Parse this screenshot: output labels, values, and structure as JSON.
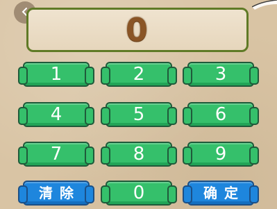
{
  "display": {
    "value": "0"
  },
  "keys": {
    "k1": "1",
    "k2": "2",
    "k3": "3",
    "k4": "4",
    "k5": "5",
    "k6": "6",
    "k7": "7",
    "k8": "8",
    "k9": "9",
    "clear": "清除",
    "k0": "0",
    "confirm": "确定"
  },
  "colors": {
    "digit_key": "#35c06b",
    "action_key": "#1e86dd",
    "display_border": "#5f7a26",
    "display_text": "#8a5526",
    "background": "#d9c4a4"
  },
  "icons": {
    "back": "chevron-left-icon"
  }
}
